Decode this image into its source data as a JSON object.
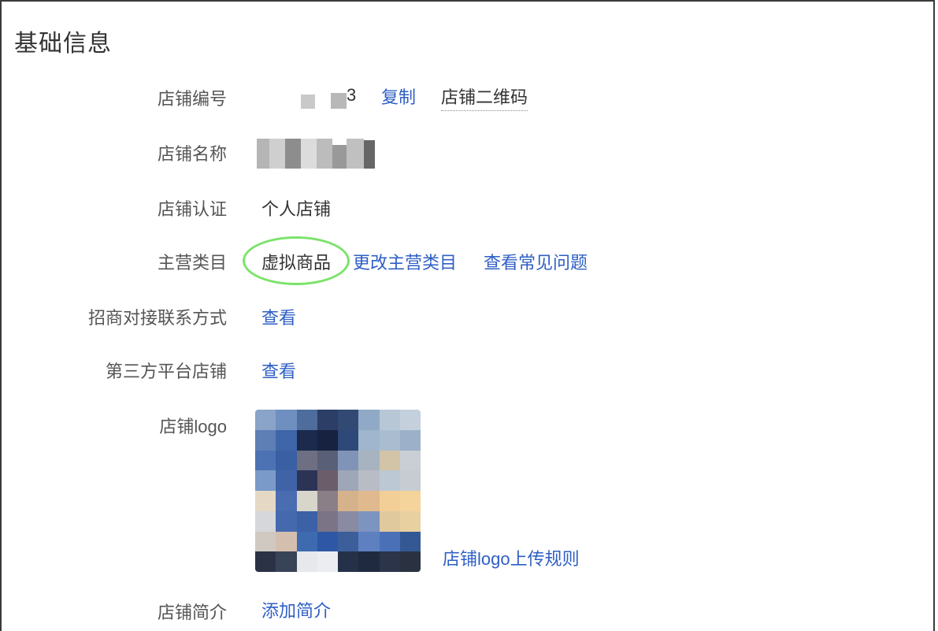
{
  "page": {
    "title": "基础信息"
  },
  "fields": {
    "shop_id": {
      "label": "店铺编号",
      "value_tail": "3",
      "copy_label": "复制",
      "qr_label": "店铺二维码"
    },
    "shop_name": {
      "label": "店铺名称"
    },
    "certification": {
      "label": "店铺认证",
      "value": "个人店铺"
    },
    "category": {
      "label": "主营类目",
      "value": "虚拟商品",
      "change_label": "更改主营类目",
      "faq_label": "查看常见问题"
    },
    "contact": {
      "label": "招商对接联系方式",
      "view_label": "查看"
    },
    "third_party": {
      "label": "第三方平台店铺",
      "view_label": "查看"
    },
    "logo": {
      "label": "店铺logo",
      "rules_label": "店铺logo上传规则"
    },
    "intro": {
      "label": "店铺简介",
      "add_label": "添加简介"
    }
  },
  "colors": {
    "link": "#2f5fc4",
    "annotation": "#7be36a"
  },
  "icons": {
    "logo_image": "shop-logo-pixelated"
  }
}
